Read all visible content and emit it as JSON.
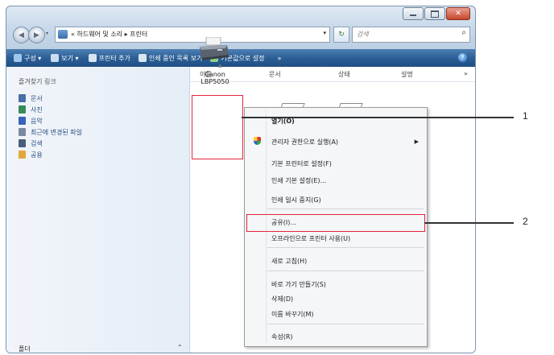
{
  "address_bar": {
    "path": "« 하드웨어 및 소리 ▸ 프린터"
  },
  "search": {
    "placeholder": "검색"
  },
  "toolbar": {
    "items": [
      {
        "label": "구성 ▾",
        "icon": "organize-icon"
      },
      {
        "label": "보기 ▾",
        "icon": "views-icon"
      },
      {
        "label": "프린터 추가",
        "icon": "add-printer-icon"
      },
      {
        "label": "인쇄 중인 목록 보기",
        "icon": "print-queue-icon"
      },
      {
        "label": "기본값으로 설정",
        "icon": "default-printer-icon"
      },
      {
        "label": "»",
        "icon": ""
      }
    ]
  },
  "sidebar": {
    "title": "즐겨찾기 링크",
    "items": [
      {
        "label": "문서",
        "color": "#4a6fa8"
      },
      {
        "label": "사진",
        "color": "#3b8a5a"
      },
      {
        "label": "음악",
        "color": "#3a63b8"
      },
      {
        "label": "최근에 변경된 파일",
        "color": "#7a8aa0"
      },
      {
        "label": "검색",
        "color": "#4b5f7a"
      },
      {
        "label": "공용",
        "color": "#e0a83a"
      }
    ],
    "folders_label": "폴더"
  },
  "columns": [
    "이름",
    "문서",
    "상태",
    "설명",
    "»"
  ],
  "printer": {
    "label_line1": "Canon",
    "label_line2": "LBP5050"
  },
  "context_menu": {
    "items": [
      {
        "label": "열기(O)"
      },
      {
        "label": "관리자 권한으로 실행(A)"
      },
      {
        "label": "기본 프린터로 설정(F)"
      },
      {
        "label": "인쇄 기본 설정(E)..."
      },
      {
        "label": "인쇄 일시 중지(G)"
      },
      {
        "label": "공유(I)..."
      },
      {
        "label": "오프라인으로 프린터 사용(U)"
      },
      {
        "label": "새로 고침(H)"
      },
      {
        "label": "바로 가기 만들기(S)"
      },
      {
        "label": "삭제(D)"
      },
      {
        "label": "이름 바꾸기(M)"
      },
      {
        "label": "속성(R)"
      }
    ]
  },
  "callouts": [
    "1",
    "2"
  ]
}
